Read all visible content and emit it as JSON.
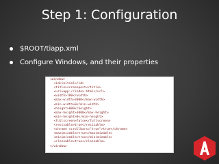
{
  "slide": {
    "title": "Step 1: Configuration",
    "bullets": [
      "$ROOT/tiapp.xml",
      "Configure Windows, and their properties"
    ]
  },
  "code_snippet": {
    "lines": [
      "<window>",
      "  <id>initial</id>",
      "  <title>screenpost</title>",
      "  <url>app://index.html</url>",
      "  <width>700</width>",
      "  <max-width>3000</max-width>",
      "  <min-width>0</min-width>",
      "  <height>800</height>",
      "  <max-height>3000</max-height>",
      "  <min-height>0</min-height>",
      "  <fullscreen>false</fullscreen>",
      "  <resizable>true</resizable>",
      "  <chrome scrollbars=\"true\">true</chrome>",
      "  <maximizable>true</maximizable>",
      "  <minimizable>true</minimizable>",
      "  <closeable>true</closeable>",
      "</window>"
    ]
  },
  "logo": {
    "icon": "appcelerator-logo-icon",
    "color": "#d6262b"
  },
  "colors": {
    "background": "#3a3a3a",
    "text": "#ffffff",
    "code_text": "#8a2a2a",
    "accent": "#d6262b"
  }
}
